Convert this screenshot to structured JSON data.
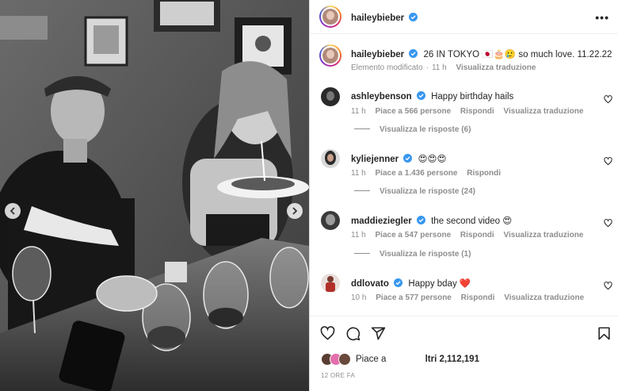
{
  "post": {
    "author": "haileybieber",
    "more_label": "•••"
  },
  "caption": {
    "username": "haileybieber",
    "text": "26 IN TOKYO 🇯🇵🎂🥲 so much love. 11.22.22",
    "edited": "Elemento modificato",
    "time": "11 h",
    "translate": "Visualizza traduzione"
  },
  "comments": [
    {
      "username": "ashleybenson",
      "text": "Happy birthday hails",
      "time": "11 h",
      "likes": "Piace a 566 persone",
      "reply": "Rispondi",
      "translate": "Visualizza traduzione",
      "replies": "Visualizza le risposte (6)"
    },
    {
      "username": "kyliejenner",
      "text": "😍😍😍",
      "time": "11 h",
      "likes": "Piace a 1.436 persone",
      "reply": "Rispondi",
      "translate": "",
      "replies": "Visualizza le risposte (24)"
    },
    {
      "username": "maddieziegler",
      "text": "the second video 😍",
      "time": "11 h",
      "likes": "Piace a 547 persone",
      "reply": "Rispondi",
      "translate": "Visualizza traduzione",
      "replies": "Visualizza le risposte (1)"
    },
    {
      "username": "ddlovato",
      "text": "Happy bday ❤️",
      "time": "10 h",
      "likes": "Piace a 577 persone",
      "reply": "Rispondi",
      "translate": "Visualizza traduzione",
      "replies": ""
    }
  ],
  "likes": {
    "prefix": "Piace a",
    "suffix": "ltri 2,112,191"
  },
  "time_ago": "12 ORE FA",
  "icons": {
    "like": "heart-icon",
    "comment": "comment-icon",
    "share": "share-icon",
    "save": "bookmark-icon",
    "verified": "verified-badge-icon",
    "prev": "chevron-left-icon",
    "next": "chevron-right-icon"
  },
  "colors": {
    "verified": "#3897f0",
    "text": "#262626",
    "muted": "#8e8e8e",
    "heart_red": "#e0245e"
  }
}
